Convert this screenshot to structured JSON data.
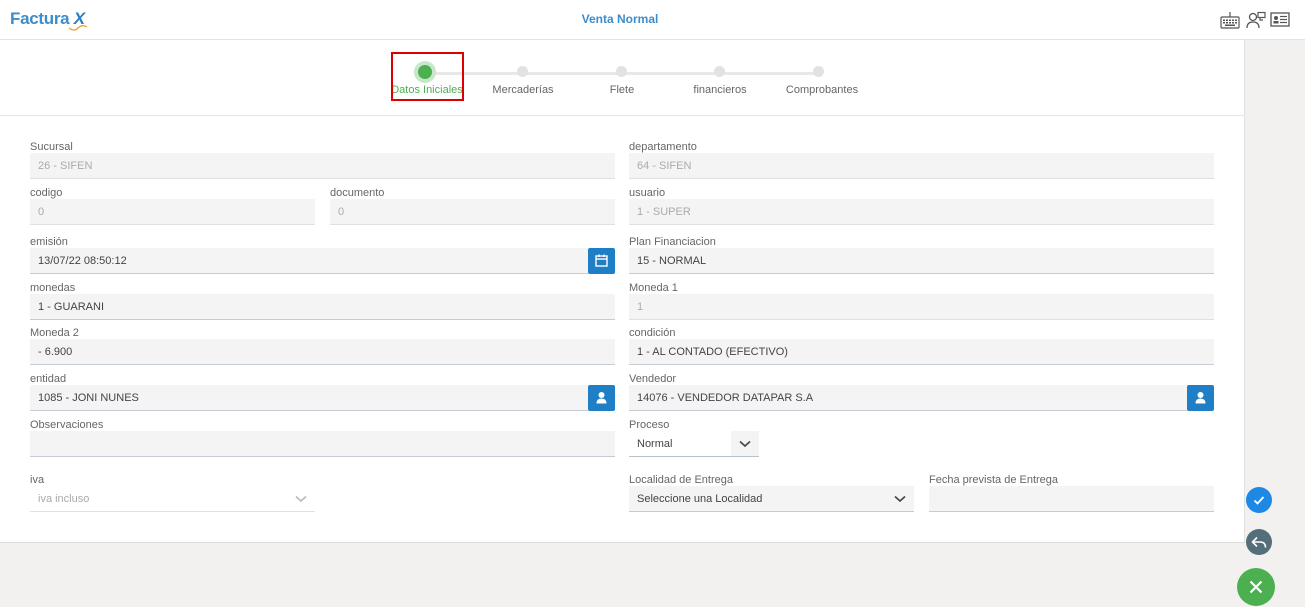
{
  "app": {
    "logo_text": "Factura",
    "logo_x": "X",
    "title": "Venta Normal"
  },
  "header_icons": [
    "keyboard-icon",
    "users-icon",
    "id-card-icon"
  ],
  "steps": [
    {
      "label": "Datos Iniciales",
      "active": true
    },
    {
      "label": "Mercaderías",
      "active": false
    },
    {
      "label": "Flete",
      "active": false
    },
    {
      "label": "financieros",
      "active": false
    },
    {
      "label": "Comprobantes",
      "active": false
    }
  ],
  "form": {
    "sucursal": {
      "label": "Sucursal",
      "value": "26 - SIFEN"
    },
    "departamento": {
      "label": "departamento",
      "value": "64 - SIFEN"
    },
    "codigo": {
      "label": "codigo",
      "value": "0"
    },
    "documento": {
      "label": "documento",
      "value": "0"
    },
    "usuario": {
      "label": "usuario",
      "value": "1 - SUPER"
    },
    "emision": {
      "label": "emisión",
      "value": "13/07/22 08:50:12"
    },
    "plan": {
      "label": "Plan Financiacion",
      "value": "15 - NORMAL"
    },
    "monedas": {
      "label": "monedas",
      "value": "1 - GUARANI"
    },
    "moneda1": {
      "label": "Moneda 1",
      "value": "1"
    },
    "moneda2": {
      "label": "Moneda 2",
      "value": "- 6.900"
    },
    "condicion": {
      "label": "condición",
      "value": "1 - AL CONTADO (EFECTIVO)"
    },
    "entidad": {
      "label": "entidad",
      "value": "1085 - JONI NUNES"
    },
    "vendedor": {
      "label": "Vendedor",
      "value": "14076 - VENDEDOR DATAPAR S.A"
    },
    "observaciones": {
      "label": "Observaciones",
      "value": ""
    },
    "proceso": {
      "label": "Proceso",
      "value": "Normal"
    },
    "iva": {
      "label": "iva",
      "value": "iva incluso"
    },
    "localidad": {
      "label": "Localidad de Entrega",
      "value": "Seleccione una Localidad"
    },
    "fecha_prevista": {
      "label": "Fecha prevista de Entrega",
      "value": ""
    }
  },
  "colors": {
    "accent": "#1f7fc6",
    "success": "#4caf50",
    "confirm": "#1e88e5",
    "back": "#546e7a"
  }
}
